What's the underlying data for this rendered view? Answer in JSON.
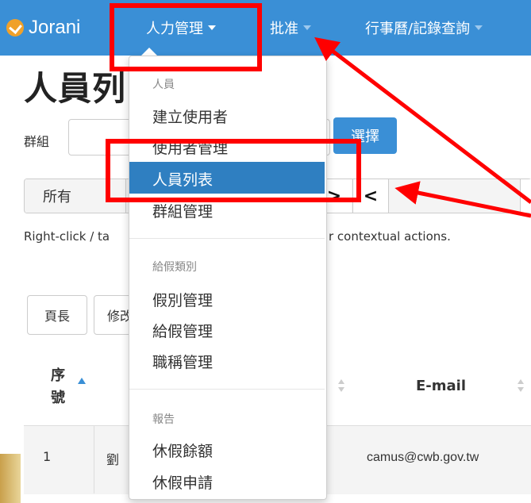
{
  "navbar": {
    "brand": "Jorani",
    "menus": [
      {
        "label": "人力管理"
      },
      {
        "label": "批准"
      },
      {
        "label": "行事曆/記錄查詢"
      }
    ]
  },
  "page": {
    "title": "人員列",
    "group_label": "群組",
    "select_button": "選擇",
    "filter_all": "所有",
    "next_arrow": ">",
    "prev_arrow": "<",
    "hint_left": "Right-click / ta",
    "hint_right": "r contextual actions.",
    "button_head": "頁長",
    "button_modify": "修改"
  },
  "table": {
    "headers": {
      "seq": "序號",
      "email": "E-mail"
    },
    "rows": [
      {
        "num": "1",
        "name": "劉",
        "email": "camus@cwb.gov.tw"
      }
    ]
  },
  "dropdown": {
    "sections": [
      {
        "header": "人員",
        "items": [
          "建立使用者",
          "使用者管理",
          "人員列表",
          "群組管理"
        ]
      },
      {
        "header": "給假類別",
        "items": [
          "假別管理",
          "給假管理",
          "職稱管理"
        ]
      },
      {
        "header": "報告",
        "items": [
          "休假餘額",
          "休假申請"
        ]
      }
    ],
    "active_item": "人員列表"
  },
  "colors": {
    "navbar": "#3a8fd6",
    "active": "#2f7fc1",
    "annotation": "#ff0000",
    "logo": "#f0a12a"
  }
}
